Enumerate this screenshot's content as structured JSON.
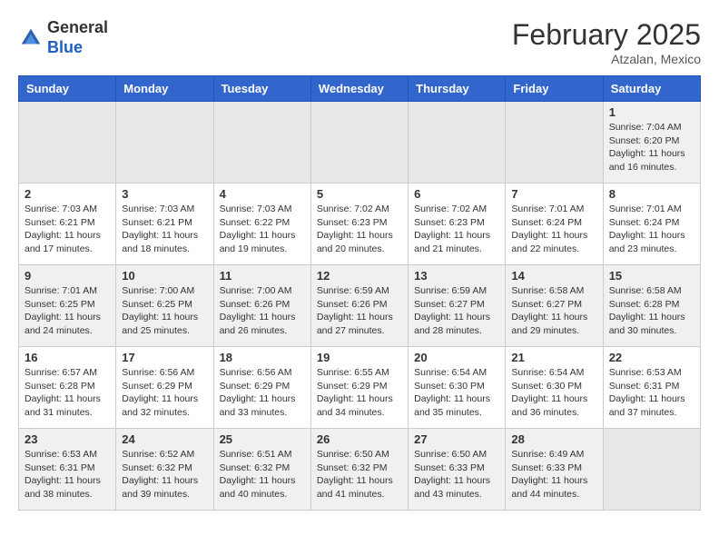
{
  "header": {
    "logo_general": "General",
    "logo_blue": "Blue",
    "month": "February 2025",
    "location": "Atzalan, Mexico"
  },
  "weekdays": [
    "Sunday",
    "Monday",
    "Tuesday",
    "Wednesday",
    "Thursday",
    "Friday",
    "Saturday"
  ],
  "weeks": [
    [
      {
        "day": "",
        "info": ""
      },
      {
        "day": "",
        "info": ""
      },
      {
        "day": "",
        "info": ""
      },
      {
        "day": "",
        "info": ""
      },
      {
        "day": "",
        "info": ""
      },
      {
        "day": "",
        "info": ""
      },
      {
        "day": "1",
        "info": "Sunrise: 7:04 AM\nSunset: 6:20 PM\nDaylight: 11 hours and 16 minutes."
      }
    ],
    [
      {
        "day": "2",
        "info": "Sunrise: 7:03 AM\nSunset: 6:21 PM\nDaylight: 11 hours and 17 minutes."
      },
      {
        "day": "3",
        "info": "Sunrise: 7:03 AM\nSunset: 6:21 PM\nDaylight: 11 hours and 18 minutes."
      },
      {
        "day": "4",
        "info": "Sunrise: 7:03 AM\nSunset: 6:22 PM\nDaylight: 11 hours and 19 minutes."
      },
      {
        "day": "5",
        "info": "Sunrise: 7:02 AM\nSunset: 6:23 PM\nDaylight: 11 hours and 20 minutes."
      },
      {
        "day": "6",
        "info": "Sunrise: 7:02 AM\nSunset: 6:23 PM\nDaylight: 11 hours and 21 minutes."
      },
      {
        "day": "7",
        "info": "Sunrise: 7:01 AM\nSunset: 6:24 PM\nDaylight: 11 hours and 22 minutes."
      },
      {
        "day": "8",
        "info": "Sunrise: 7:01 AM\nSunset: 6:24 PM\nDaylight: 11 hours and 23 minutes."
      }
    ],
    [
      {
        "day": "9",
        "info": "Sunrise: 7:01 AM\nSunset: 6:25 PM\nDaylight: 11 hours and 24 minutes."
      },
      {
        "day": "10",
        "info": "Sunrise: 7:00 AM\nSunset: 6:25 PM\nDaylight: 11 hours and 25 minutes."
      },
      {
        "day": "11",
        "info": "Sunrise: 7:00 AM\nSunset: 6:26 PM\nDaylight: 11 hours and 26 minutes."
      },
      {
        "day": "12",
        "info": "Sunrise: 6:59 AM\nSunset: 6:26 PM\nDaylight: 11 hours and 27 minutes."
      },
      {
        "day": "13",
        "info": "Sunrise: 6:59 AM\nSunset: 6:27 PM\nDaylight: 11 hours and 28 minutes."
      },
      {
        "day": "14",
        "info": "Sunrise: 6:58 AM\nSunset: 6:27 PM\nDaylight: 11 hours and 29 minutes."
      },
      {
        "day": "15",
        "info": "Sunrise: 6:58 AM\nSunset: 6:28 PM\nDaylight: 11 hours and 30 minutes."
      }
    ],
    [
      {
        "day": "16",
        "info": "Sunrise: 6:57 AM\nSunset: 6:28 PM\nDaylight: 11 hours and 31 minutes."
      },
      {
        "day": "17",
        "info": "Sunrise: 6:56 AM\nSunset: 6:29 PM\nDaylight: 11 hours and 32 minutes."
      },
      {
        "day": "18",
        "info": "Sunrise: 6:56 AM\nSunset: 6:29 PM\nDaylight: 11 hours and 33 minutes."
      },
      {
        "day": "19",
        "info": "Sunrise: 6:55 AM\nSunset: 6:29 PM\nDaylight: 11 hours and 34 minutes."
      },
      {
        "day": "20",
        "info": "Sunrise: 6:54 AM\nSunset: 6:30 PM\nDaylight: 11 hours and 35 minutes."
      },
      {
        "day": "21",
        "info": "Sunrise: 6:54 AM\nSunset: 6:30 PM\nDaylight: 11 hours and 36 minutes."
      },
      {
        "day": "22",
        "info": "Sunrise: 6:53 AM\nSunset: 6:31 PM\nDaylight: 11 hours and 37 minutes."
      }
    ],
    [
      {
        "day": "23",
        "info": "Sunrise: 6:53 AM\nSunset: 6:31 PM\nDaylight: 11 hours and 38 minutes."
      },
      {
        "day": "24",
        "info": "Sunrise: 6:52 AM\nSunset: 6:32 PM\nDaylight: 11 hours and 39 minutes."
      },
      {
        "day": "25",
        "info": "Sunrise: 6:51 AM\nSunset: 6:32 PM\nDaylight: 11 hours and 40 minutes."
      },
      {
        "day": "26",
        "info": "Sunrise: 6:50 AM\nSunset: 6:32 PM\nDaylight: 11 hours and 41 minutes."
      },
      {
        "day": "27",
        "info": "Sunrise: 6:50 AM\nSunset: 6:33 PM\nDaylight: 11 hours and 43 minutes."
      },
      {
        "day": "28",
        "info": "Sunrise: 6:49 AM\nSunset: 6:33 PM\nDaylight: 11 hours and 44 minutes."
      },
      {
        "day": "",
        "info": ""
      }
    ]
  ]
}
